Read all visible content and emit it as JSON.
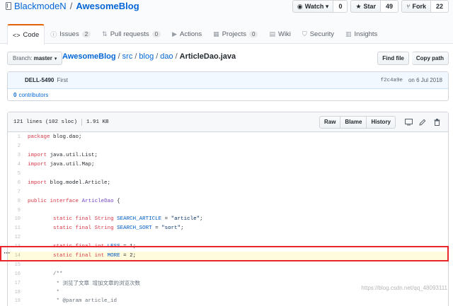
{
  "repo": {
    "owner": "BlackmodeN",
    "separator": "/",
    "name": "AwesomeBlog"
  },
  "actions": {
    "watch": {
      "label": "Watch ▾",
      "count": "0"
    },
    "star": {
      "label": "Star",
      "count": "49"
    },
    "fork": {
      "label": "Fork",
      "count": "22"
    }
  },
  "tabs": [
    {
      "label": "Code",
      "icon": "code-icon"
    },
    {
      "label": "Issues",
      "count": "2",
      "icon": "issue-icon"
    },
    {
      "label": "Pull requests",
      "count": "0",
      "icon": "pull-request-icon"
    },
    {
      "label": "Actions",
      "icon": "play-icon"
    },
    {
      "label": "Projects",
      "count": "0",
      "icon": "project-icon"
    },
    {
      "label": "Wiki",
      "icon": "book-icon"
    },
    {
      "label": "Security",
      "icon": "shield-icon"
    },
    {
      "label": "Insights",
      "icon": "graph-icon"
    }
  ],
  "branch": {
    "label": "Branch:",
    "value": "master"
  },
  "breadcrumb": {
    "root": "AwesomeBlog",
    "parts": [
      "src",
      "blog",
      "dao"
    ],
    "final": "ArticleDao.java"
  },
  "file_nav": {
    "find_file": "Find file",
    "copy_path": "Copy path"
  },
  "commit": {
    "author": "DELL-5490",
    "message": "First",
    "sha": "f2c4a9e",
    "date": "on 6 Jul 2018"
  },
  "contributors": {
    "count": "0",
    "label": "contributors"
  },
  "file_info": {
    "lines": "121 lines (102 sloc)",
    "size": "1.91 KB"
  },
  "file_buttons": {
    "raw": "Raw",
    "blame": "Blame",
    "history": "History"
  },
  "code_lines": [
    {
      "n": "1",
      "t": "package blog.dao;"
    },
    {
      "n": "2",
      "t": ""
    },
    {
      "n": "3",
      "t": "import java.util.List;"
    },
    {
      "n": "4",
      "t": "import java.util.Map;"
    },
    {
      "n": "5",
      "t": ""
    },
    {
      "n": "6",
      "t": "import blog.model.Article;"
    },
    {
      "n": "7",
      "t": ""
    },
    {
      "n": "8",
      "t": "public interface ArticleDao {"
    },
    {
      "n": "9",
      "t": ""
    },
    {
      "n": "10",
      "t": "        static final String SEARCH_ARTICLE = \"article\";"
    },
    {
      "n": "11",
      "t": "        static final String SEARCH_SORT = \"sort\";"
    },
    {
      "n": "12",
      "t": ""
    },
    {
      "n": "13",
      "t": "        static final int LESS = 1;"
    },
    {
      "n": "14",
      "t": "        static final int MORE = 2;"
    },
    {
      "n": "15",
      "t": ""
    },
    {
      "n": "16",
      "t": "        /**"
    },
    {
      "n": "17",
      "t": "         * 浏览了文章 增加文章的浏览次数"
    },
    {
      "n": "18",
      "t": "         *"
    },
    {
      "n": "19",
      "t": "         * @param article_id"
    }
  ],
  "highlighted_line": "14",
  "watermark": "https://blog.csdn.net/qq_48093111"
}
